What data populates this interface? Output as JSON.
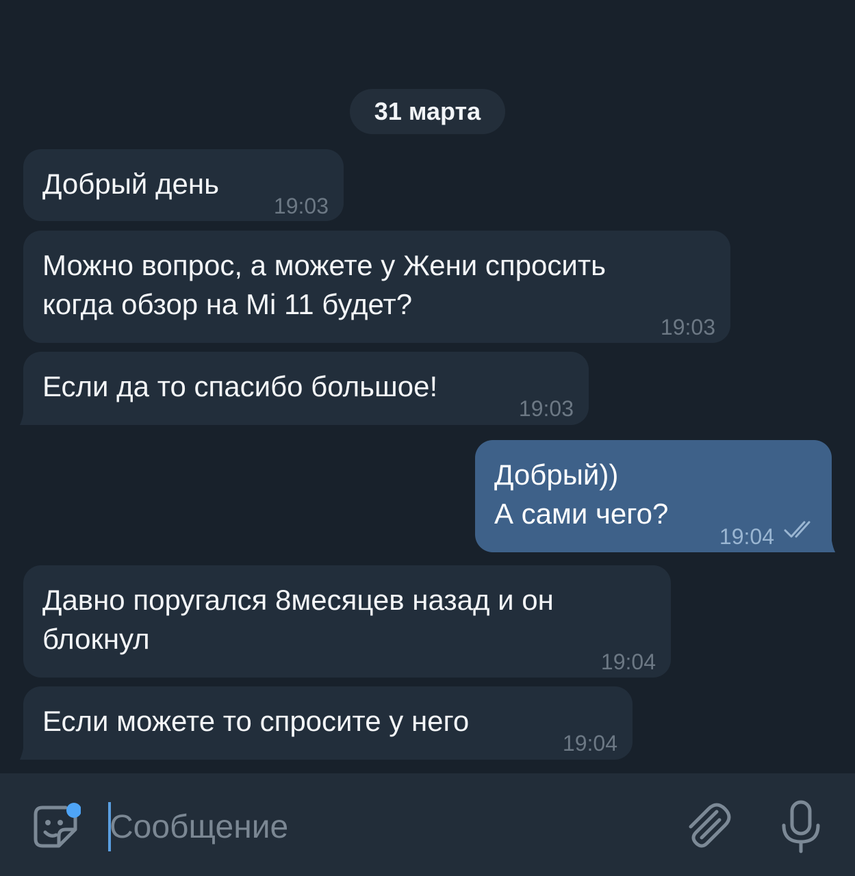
{
  "date_separator": "31 марта",
  "messages": [
    {
      "direction": "incoming",
      "lines": "Добрый день",
      "time": "19:03"
    },
    {
      "direction": "incoming",
      "lines": "Можно вопрос, а можете у Жени спросить\nкогда обзор на Mi 11 будет?",
      "time": "19:03"
    },
    {
      "direction": "incoming",
      "lines": "Если да то спасибо большое!",
      "time": "19:03"
    },
    {
      "direction": "outgoing",
      "lines": "Добрый))\nА сами чего?",
      "time": "19:04",
      "status": "read"
    },
    {
      "direction": "incoming",
      "lines": "Давно поругался 8месяцев назад и он\nблокнул",
      "time": "19:04"
    },
    {
      "direction": "incoming",
      "lines": "Если можете то спросите у него",
      "time": "19:04"
    }
  ],
  "composer": {
    "placeholder": "Сообщение",
    "value": "",
    "emoji_icon": "sticker-emoji-icon",
    "attach_icon": "paperclip-icon",
    "mic_icon": "microphone-icon",
    "badge_color": "#4ea4f6"
  },
  "colors": {
    "background": "#18212b",
    "incoming_bubble": "#222e3b",
    "outgoing_bubble": "#3e6189",
    "read_checks": "#9ab6d2"
  }
}
